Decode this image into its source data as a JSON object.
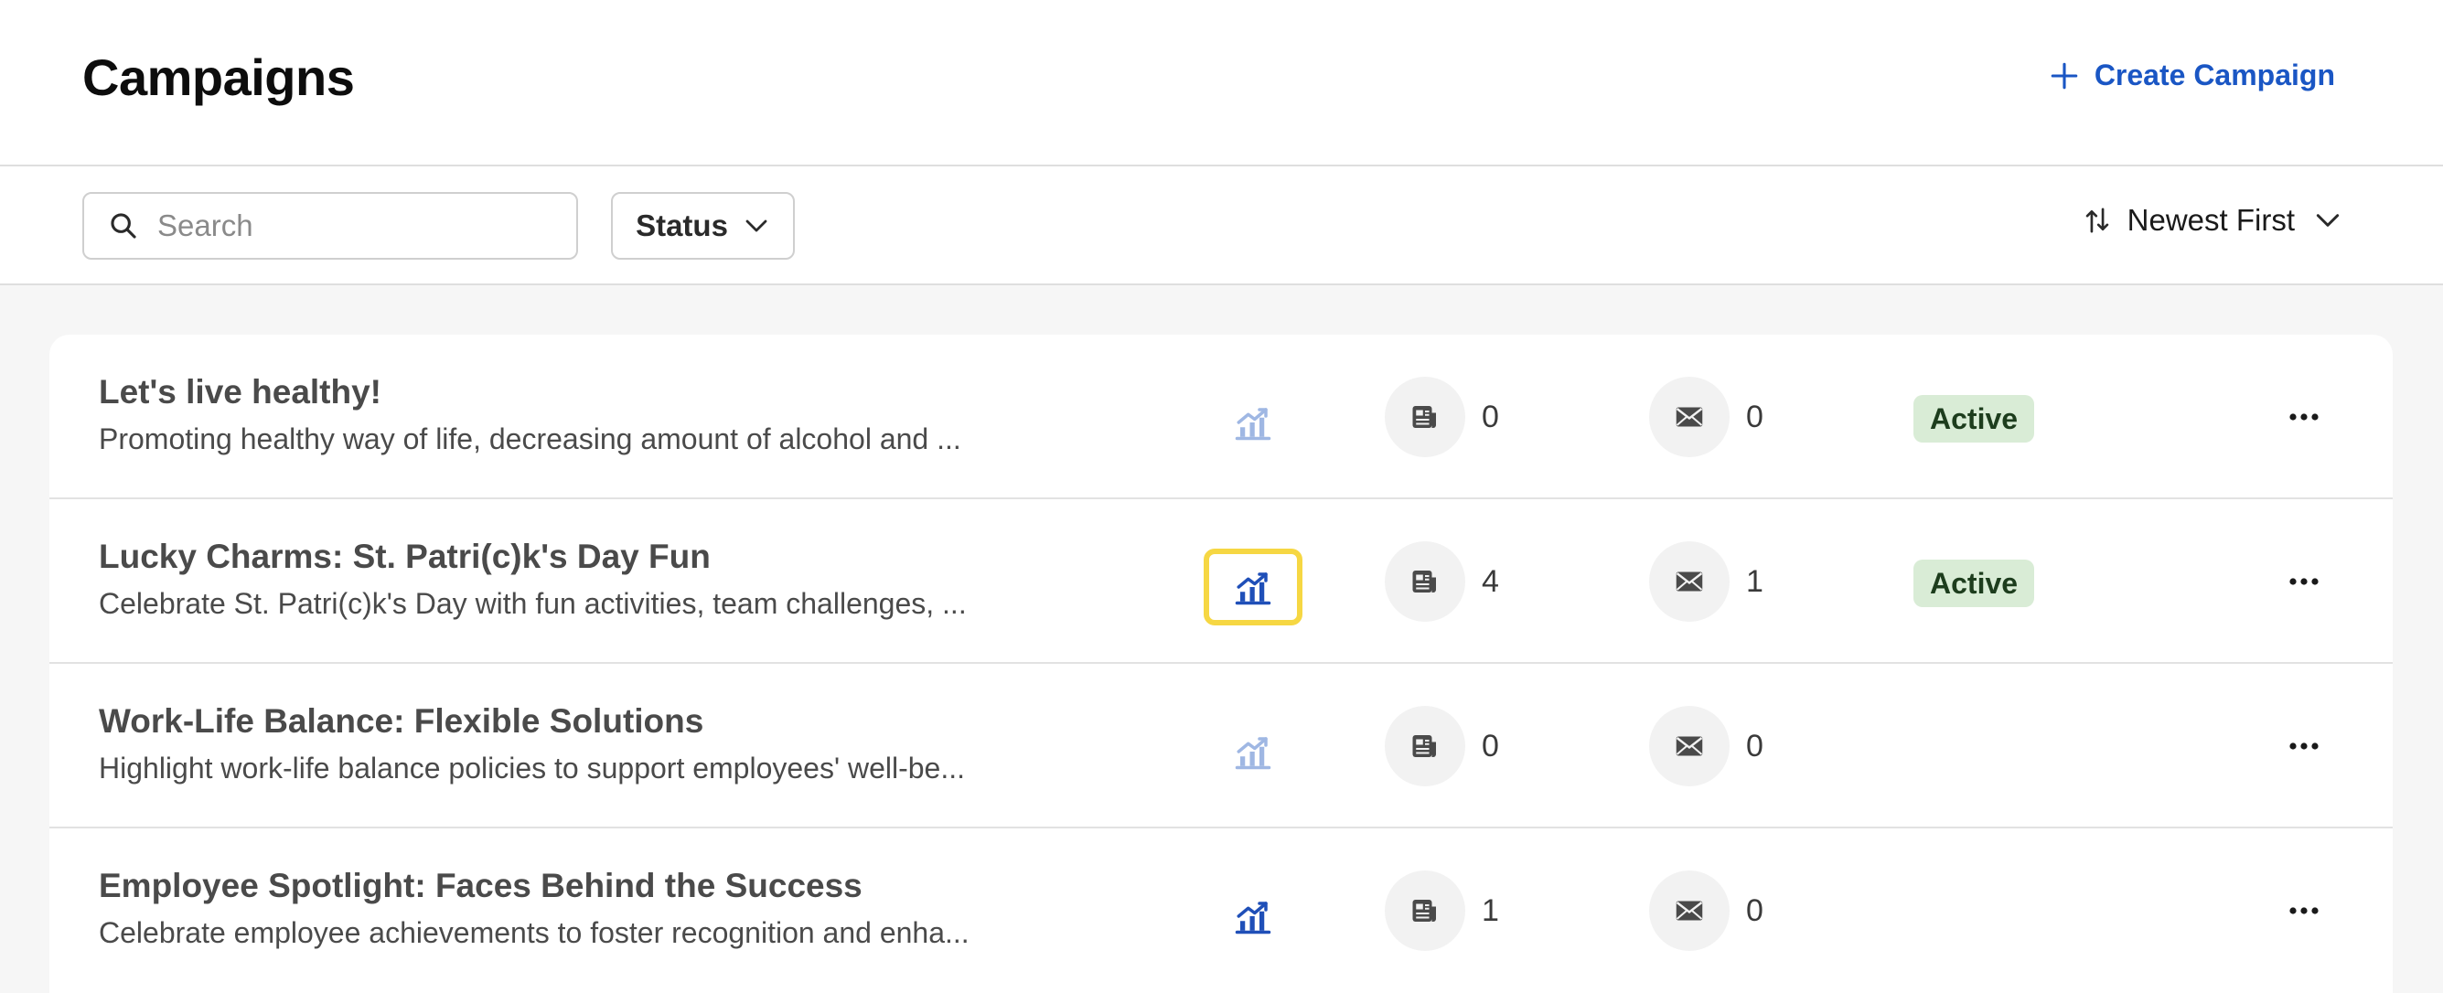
{
  "header": {
    "title": "Campaigns",
    "create_label": "Create Campaign"
  },
  "toolbar": {
    "search_placeholder": "Search",
    "status_label": "Status",
    "sort_label": "Newest First"
  },
  "colors": {
    "accent": "#1a56c4",
    "highlight": "#f6d743",
    "badge_bg": "#d9ecd6"
  },
  "campaigns": [
    {
      "title": "Let's live healthy!",
      "description": "Promoting healthy way of life, decreasing amount of alcohol and ...",
      "posts": "0",
      "emails": "0",
      "status": "Active",
      "analytics_icon": "chart-growth-icon-muted"
    },
    {
      "title": "Lucky Charms: St. Patri(c)k's Day Fun",
      "description": "Celebrate St. Patri(c)k's Day with fun activities, team challenges, ...",
      "posts": "4",
      "emails": "1",
      "status": "Active",
      "analytics_icon": "chart-growth-icon-active"
    },
    {
      "title": "Work-Life Balance: Flexible Solutions",
      "description": "Highlight work-life balance policies to support employees' well-be...",
      "posts": "0",
      "emails": "0",
      "status": "",
      "analytics_icon": "chart-growth-icon-muted"
    },
    {
      "title": "Employee Spotlight: Faces Behind the Success",
      "description": "Celebrate employee achievements to foster recognition and enha...",
      "posts": "1",
      "emails": "0",
      "status": "",
      "analytics_icon": "chart-growth-icon-active"
    }
  ]
}
